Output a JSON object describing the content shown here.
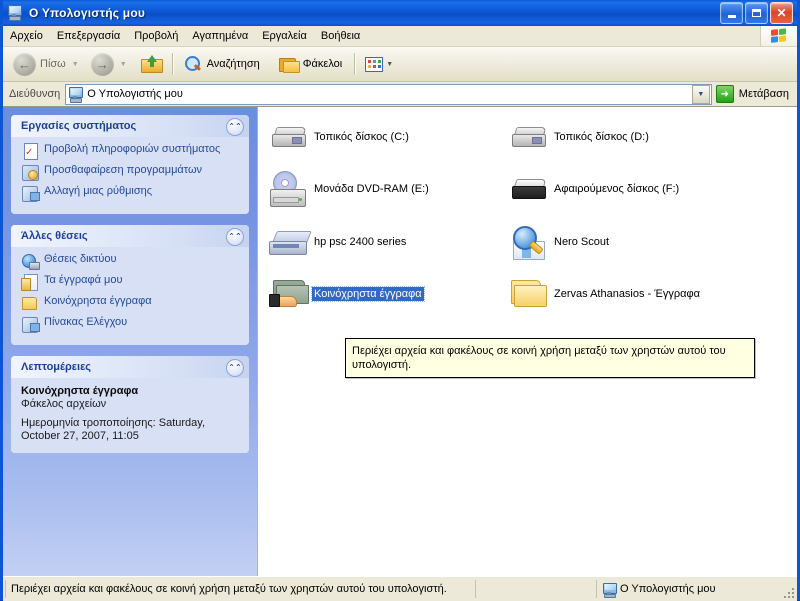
{
  "window": {
    "title": "Ο Υπολογιστής μου",
    "title_icon": "my-computer-icon",
    "buttons": {
      "minimize": "_",
      "maximize": "□",
      "close": "✕"
    }
  },
  "menubar": {
    "items": [
      {
        "label": "Αρχείο"
      },
      {
        "label": "Επεξεργασία"
      },
      {
        "label": "Προβολή"
      },
      {
        "label": "Αγαπημένα"
      },
      {
        "label": "Εργαλεία"
      },
      {
        "label": "Βοήθεια"
      }
    ],
    "logo": "windows-flag-icon"
  },
  "toolbar": {
    "back_label": "Πίσω",
    "back_icon": "back-arrow-icon",
    "forward_icon": "forward-arrow-icon",
    "up_icon": "up-folder-icon",
    "search_label": "Αναζήτηση",
    "search_icon": "search-icon",
    "folders_label": "Φάκελοι",
    "folders_icon": "folders-icon",
    "views_icon": "views-icon",
    "dropdown_arrow": "▾"
  },
  "address": {
    "label": "Διεύθυνση",
    "value": "Ο Υπολογιστής μου",
    "icon": "my-computer-icon",
    "dropdown_arrow": "▼",
    "go_label": "Μετάβαση",
    "go_icon": "green-arrow-icon"
  },
  "sidebar": {
    "panels": [
      {
        "title": "Εργασίες συστήματος",
        "collapse_icon": "chevron-up-icon",
        "links": [
          {
            "label": "Προβολή πληροφοριών συστήματος",
            "icon": "system-info-icon"
          },
          {
            "label": "Προσθαφαίρεση προγραμμάτων",
            "icon": "add-remove-programs-icon"
          },
          {
            "label": "Αλλαγή μιας ρύθμισης",
            "icon": "change-setting-icon"
          }
        ]
      },
      {
        "title": "Άλλες θέσεις",
        "collapse_icon": "chevron-up-icon",
        "links": [
          {
            "label": "Θέσεις δικτύου",
            "icon": "network-places-icon"
          },
          {
            "label": "Τα έγγραφά μου",
            "icon": "my-documents-icon"
          },
          {
            "label": "Κοινόχρηστα έγγραφα",
            "icon": "shared-documents-icon"
          },
          {
            "label": "Πίνακας Ελέγχου",
            "icon": "control-panel-icon"
          }
        ]
      }
    ],
    "details": {
      "title": "Λεπτομέρειες",
      "collapse_icon": "chevron-up-icon",
      "item_name": "Κοινόχρηστα έγγραφα",
      "item_type": "Φάκελος αρχείων",
      "modified": "Ημερομηνία τροποποίησης: Saturday, October 27, 2007, 11:05"
    }
  },
  "content": {
    "items": [
      {
        "label": "Τοπικός δίσκος (C:)",
        "icon": "hard-disk-icon",
        "selected": false
      },
      {
        "label": "Τοπικός δίσκος (D:)",
        "icon": "hard-disk-icon",
        "selected": false
      },
      {
        "label": "Μονάδα DVD-RAM (E:)",
        "icon": "dvd-drive-icon",
        "selected": false
      },
      {
        "label": "Αφαιρούμενος δίσκος (F:)",
        "icon": "removable-disk-icon",
        "selected": false
      },
      {
        "label": "hp psc 2400 series",
        "icon": "scanner-icon",
        "selected": false
      },
      {
        "label": "Nero Scout",
        "icon": "nero-scout-icon",
        "selected": false
      },
      {
        "label": "Κοινόχρηστα έγγραφα",
        "icon": "shared-folder-icon",
        "selected": true
      },
      {
        "label": "Zervas Athanasios - Έγγραφα",
        "icon": "folder-icon",
        "selected": false
      }
    ],
    "tooltip": "Περιέχει αρχεία και φακέλους σε κοινή χρήση μεταξύ των χρηστών αυτού του υπολογιστή."
  },
  "statusbar": {
    "text": "Περιέχει αρχεία και φακέλους σε κοινή χρήση μεταξύ των χρηστών αυτού του υπολογιστή.",
    "middle": "",
    "right": "Ο Υπολογιστής μου",
    "right_icon": "my-computer-icon"
  },
  "colors": {
    "titlebar_blue": "#0b56d6",
    "selection_blue": "#316ac5",
    "sidebar_gradient_top": "#6b8ede",
    "panel_body": "#d8e0f6",
    "tooltip_bg": "#ffffe1",
    "chrome": "#ece9d8"
  }
}
